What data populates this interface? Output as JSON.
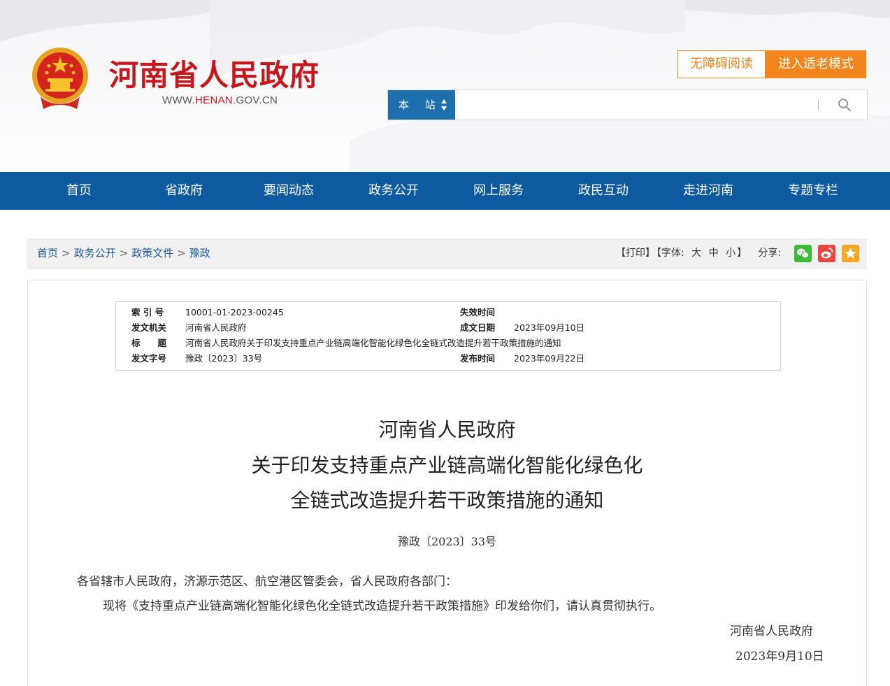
{
  "header": {
    "site_title": "河南省人民政府",
    "url_prefix": "WWW.",
    "url_domain": "HENAN",
    "url_suffix": ".GOV.CN",
    "accessibility_label": "无障碍阅读",
    "elder_mode_label": "进入适老模式",
    "search_scope": "本 站",
    "search_placeholder": ""
  },
  "nav": {
    "items": [
      "首页",
      "省政府",
      "要闻动态",
      "政务公开",
      "网上服务",
      "政民互动",
      "走进河南",
      "专题专栏"
    ]
  },
  "breadcrumb": {
    "items": [
      "首页",
      "政务公开",
      "政策文件",
      "豫政"
    ],
    "separator": ">"
  },
  "tools": {
    "print": "【打印】",
    "font_label": "【字体:",
    "font_large": "大",
    "font_medium": "中",
    "font_small": "小",
    "font_close": "】",
    "share_label": "分享:",
    "share_icons": [
      "wechat-icon",
      "weibo-icon",
      "favorite-star-icon"
    ]
  },
  "meta": {
    "index_no_label": "索 引 号",
    "index_no": "10001-01-2023-00245",
    "expire_label": "失效时间",
    "expire": "",
    "issuer_label": "发文机关",
    "issuer": "河南省人民政府",
    "made_date_label": "成文日期",
    "made_date": "2023年09月10日",
    "title_label": "标　　题",
    "title": "河南省人民政府关于印发支持重点产业链高端化智能化绿色化全链式改造提升若干政策措施的通知",
    "doc_no_label": "发文字号",
    "doc_no": "豫政〔2023〕33号",
    "publish_date_label": "发布时间",
    "publish_date": "2023年09月22日"
  },
  "document": {
    "title_line1": "河南省人民政府",
    "title_line2": "关于印发支持重点产业链高端化智能化绿色化",
    "title_line3": "全链式改造提升若干政策措施的通知",
    "doc_no": "豫政〔2023〕33号",
    "addressee": "各省辖市人民政府，济源示范区、航空港区管委会，省人民政府各部门：",
    "body": "现将《支持重点产业链高端化智能化绿色化全链式改造提升若干政策措施》印发给你们，请认真贯彻执行。",
    "signature": "河南省人民政府",
    "date": "2023年9月10日"
  },
  "colors": {
    "brand_red": "#c8161d",
    "nav_blue": "#0d5aa1",
    "accent_orange": "#f2861c",
    "search_blue": "#1d6fae"
  }
}
